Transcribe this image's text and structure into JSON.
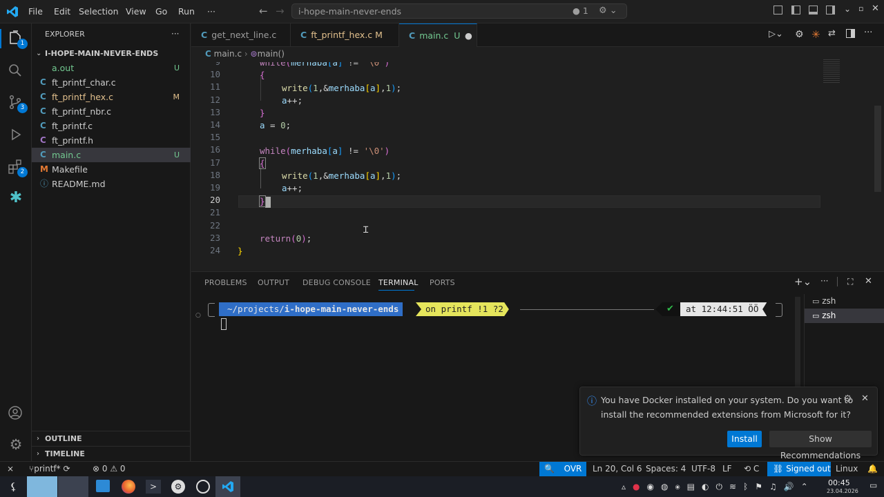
{
  "menu": {
    "file": "File",
    "edit": "Edit",
    "selection": "Selection",
    "view": "View",
    "go": "Go",
    "run": "Run",
    "more": "···"
  },
  "command_center": {
    "title": "i-hope-main-never-ends",
    "problems_count": "1"
  },
  "activity": {
    "explorer_badge": "1",
    "scm_badge": "3",
    "extensions_badge": "2"
  },
  "explorer": {
    "title": "EXPLORER",
    "more": "···",
    "folder": "I-HOPE-MAIN-NEVER-ENDS",
    "files": [
      {
        "icon": "",
        "name": "a.out",
        "status": "U"
      },
      {
        "icon": "C",
        "name": "ft_printf_char.c",
        "status": ""
      },
      {
        "icon": "C",
        "name": "ft_printf_hex.c",
        "status": "M"
      },
      {
        "icon": "C",
        "name": "ft_printf_nbr.c",
        "status": ""
      },
      {
        "icon": "C",
        "name": "ft_printf.c",
        "status": ""
      },
      {
        "icon": "C",
        "name": "ft_printf.h",
        "status": ""
      },
      {
        "icon": "C",
        "name": "main.c",
        "status": "U"
      },
      {
        "icon": "M",
        "name": "Makefile",
        "status": ""
      },
      {
        "icon": "ⓘ",
        "name": "README.md",
        "status": ""
      }
    ],
    "outline": "OUTLINE",
    "timeline": "TIMELINE"
  },
  "tabs": [
    {
      "icon": "C",
      "label": "get_next_line.c",
      "status": ""
    },
    {
      "icon": "C",
      "label": "ft_printf_hex.c",
      "status": "M"
    },
    {
      "icon": "C",
      "label": "main.c",
      "status": "U"
    }
  ],
  "breadcrumb": {
    "file": "main.c",
    "symbol": "main()"
  },
  "line_numbers": [
    "9",
    "10",
    "11",
    "12",
    "13",
    "14",
    "15",
    "16",
    "17",
    "18",
    "19",
    "20",
    "21",
    "22",
    "23",
    "24"
  ],
  "panel": {
    "tabs": [
      "PROBLEMS",
      "OUTPUT",
      "DEBUG CONSOLE",
      "TERMINAL",
      "PORTS"
    ],
    "terminals": [
      "zsh",
      "zsh"
    ]
  },
  "terminal": {
    "path": "~/projects/",
    "repo": "i-hope-main-never-ends",
    "branch": "on printf !1 ?2",
    "check": "✔",
    "time": "at 12:44:51 ÖÖ"
  },
  "notification": {
    "line1": "You have Docker installed on your system. Do you want to",
    "line2": "install the recommended extensions from Microsoft for it?",
    "install": "Install",
    "show": "Show Recommendations"
  },
  "status": {
    "branch": "printf*",
    "errors": "0",
    "warnings": "0",
    "ovr": "OVR",
    "position": "Ln 20, Col 6",
    "spaces": "Spaces: 4",
    "encoding": "UTF-8",
    "eol": "LF",
    "lang": "C",
    "signed": "Signed out",
    "os": "Linux"
  },
  "clock": {
    "time": "00:45",
    "date": "23.04.2026"
  }
}
